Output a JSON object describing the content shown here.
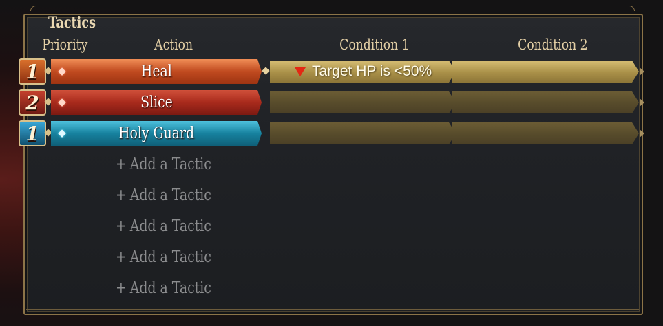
{
  "panel": {
    "title": "Tactics"
  },
  "columns": {
    "priority": "Priority",
    "action": "Action",
    "condition1": "Condition 1",
    "condition2": "Condition 2"
  },
  "tactics": [
    {
      "priority": "1",
      "color": "#c04a1f",
      "gem": "red-gem",
      "action": "Heal",
      "condition1": "Target HP is <50%",
      "condition1_icon": "down-triangle-icon",
      "condition2": ""
    },
    {
      "priority": "2",
      "color": "#a82a1c",
      "gem": "red-gem",
      "action": "Slice",
      "condition1": "",
      "condition2": ""
    },
    {
      "priority": "1",
      "color": "#17829f",
      "gem": "blue-gem",
      "action": "Holy Guard",
      "condition1": "",
      "condition2": ""
    }
  ],
  "add_slots": [
    {
      "label": "Add a Tactic",
      "icon": "plus"
    },
    {
      "label": "Add a Tactic",
      "icon": "plus"
    },
    {
      "label": "Add a Tactic",
      "icon": "plus"
    },
    {
      "label": "Add a Tactic",
      "icon": "plus"
    },
    {
      "label": "Add a Tactic",
      "icon": "plus"
    }
  ],
  "colors": {
    "frame_gold": "#8c7448",
    "condition_filled": "#a99048",
    "condition_empty": "#574b2b",
    "indicator_red": "#e32814"
  }
}
